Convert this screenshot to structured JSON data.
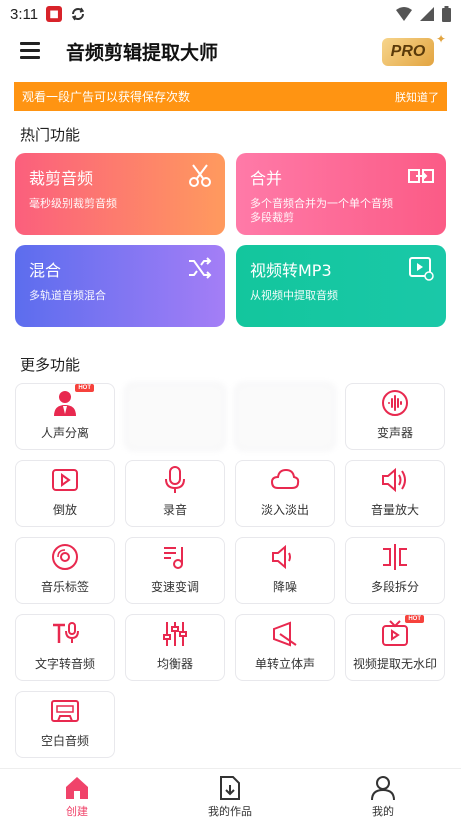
{
  "status_bar": {
    "time": "3:11",
    "notification_icon": "app-notification-icon"
  },
  "app_bar": {
    "title": "音频剪辑提取大师",
    "pro_label": "PRO"
  },
  "ad_banner": {
    "text": "观看一段广告可以获得保存次数",
    "close_label": "朕知道了",
    "color": "#ff9412"
  },
  "hot_section": {
    "title": "热门功能",
    "cards": [
      {
        "title": "裁剪音频",
        "subtitle": "毫秒级别裁剪音频",
        "icon": "scissors-icon"
      },
      {
        "title": "合并",
        "subtitle": "多个音频合并为一个单个音频多段裁剪",
        "icon": "merge-icon"
      },
      {
        "title": "混合",
        "subtitle": "多轨道音频混合",
        "icon": "shuffle-icon"
      },
      {
        "title": "视频转MP3",
        "subtitle": "从视频中提取音频",
        "icon": "video-convert-icon"
      }
    ]
  },
  "more_section": {
    "title": "更多功能",
    "hot_badge": "HOT",
    "tiles": [
      {
        "label": "人声分离",
        "icon": "vocal-separation-icon"
      },
      {
        "label": "",
        "icon": "blurred-icon"
      },
      {
        "label": "",
        "icon": "blurred-icon"
      },
      {
        "label": "变声器",
        "icon": "voice-changer-icon"
      },
      {
        "label": "倒放",
        "icon": "reverse-play-icon"
      },
      {
        "label": "录音",
        "icon": "microphone-icon"
      },
      {
        "label": "淡入淡出",
        "icon": "cloud-icon"
      },
      {
        "label": "音量放大",
        "icon": "volume-icon"
      },
      {
        "label": "音乐标签",
        "icon": "disc-icon"
      },
      {
        "label": "变速变调",
        "icon": "music-note-icon"
      },
      {
        "label": "降噪",
        "icon": "speaker-low-icon"
      },
      {
        "label": "多段拆分",
        "icon": "split-icon"
      },
      {
        "label": "文字转音频",
        "icon": "text-to-speech-icon"
      },
      {
        "label": "均衡器",
        "icon": "equalizer-icon"
      },
      {
        "label": "单转立体声",
        "icon": "stereo-icon"
      },
      {
        "label": "视频提取无水印",
        "icon": "tv-icon"
      },
      {
        "label": "空白音频",
        "icon": "cassette-icon"
      }
    ]
  },
  "bottom_nav": [
    {
      "label": "创建",
      "icon": "home-icon"
    },
    {
      "label": "我的作品",
      "icon": "download-doc-icon"
    },
    {
      "label": "我的",
      "icon": "person-icon"
    }
  ],
  "accent_color": "#f0436a"
}
